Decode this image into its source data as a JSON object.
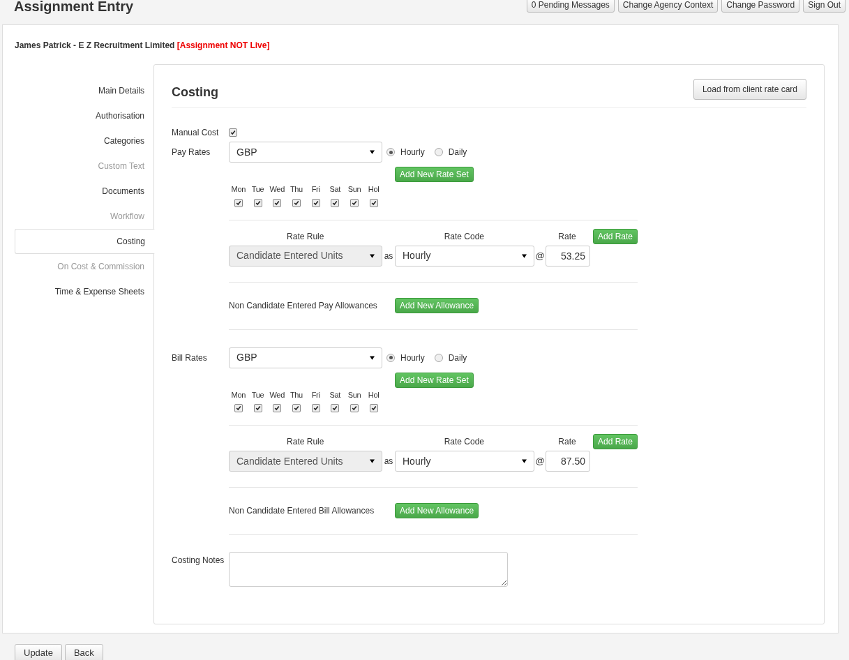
{
  "header": {
    "title": "Assignment Entry",
    "buttons": [
      "0 Pending Messages",
      "Change Agency Context",
      "Change Password",
      "Sign Out"
    ]
  },
  "candidate": {
    "name": "James Patrick - E Z Recruitment Limited",
    "status": "[Assignment NOT Live]"
  },
  "sidebar": {
    "items": [
      {
        "label": "Main Details",
        "selected": false,
        "disabled": false
      },
      {
        "label": "Authorisation",
        "selected": false,
        "disabled": false
      },
      {
        "label": "Categories",
        "selected": false,
        "disabled": false
      },
      {
        "label": "Custom Text",
        "selected": false,
        "disabled": true
      },
      {
        "label": "Documents",
        "selected": false,
        "disabled": false
      },
      {
        "label": "Workflow",
        "selected": false,
        "disabled": true
      },
      {
        "label": "Costing",
        "selected": true,
        "disabled": false
      },
      {
        "label": "On Cost & Commission",
        "selected": false,
        "disabled": true
      },
      {
        "label": "Time & Expense Sheets",
        "selected": false,
        "disabled": false
      }
    ]
  },
  "costing": {
    "title": "Costing",
    "load_button": "Load from client rate card",
    "manual_cost": {
      "label": "Manual Cost",
      "checked": true
    },
    "rate_sections": [
      {
        "label": "Pay Rates",
        "currency": "GBP",
        "periods": [
          {
            "label": "Hourly",
            "selected": true
          },
          {
            "label": "Daily",
            "selected": false
          }
        ],
        "add_rate_set": "Add New Rate Set",
        "days": [
          {
            "label": "Mon",
            "checked": true
          },
          {
            "label": "Tue",
            "checked": true
          },
          {
            "label": "Wed",
            "checked": true
          },
          {
            "label": "Thu",
            "checked": true
          },
          {
            "label": "Fri",
            "checked": true
          },
          {
            "label": "Sat",
            "checked": true
          },
          {
            "label": "Sun",
            "checked": true
          },
          {
            "label": "Hol",
            "checked": true
          }
        ],
        "rate_headers": [
          "Rate Rule",
          "Rate Code",
          "Rate"
        ],
        "add_rate": "Add Rate",
        "rate_rule": "Candidate Entered Units",
        "as": "as",
        "rate_code": "Hourly",
        "at": "@",
        "rate": "53.25",
        "allowances_label": "Non Candidate Entered Pay Allowances",
        "add_allowance": "Add New Allowance"
      },
      {
        "label": "Bill Rates",
        "currency": "GBP",
        "periods": [
          {
            "label": "Hourly",
            "selected": true
          },
          {
            "label": "Daily",
            "selected": false
          }
        ],
        "add_rate_set": "Add New Rate Set",
        "days": [
          {
            "label": "Mon",
            "checked": true
          },
          {
            "label": "Tue",
            "checked": true
          },
          {
            "label": "Wed",
            "checked": true
          },
          {
            "label": "Thu",
            "checked": true
          },
          {
            "label": "Fri",
            "checked": true
          },
          {
            "label": "Sat",
            "checked": true
          },
          {
            "label": "Sun",
            "checked": true
          },
          {
            "label": "Hol",
            "checked": true
          }
        ],
        "rate_headers": [
          "Rate Rule",
          "Rate Code",
          "Rate"
        ],
        "add_rate": "Add Rate",
        "rate_rule": "Candidate Entered Units",
        "as": "as",
        "rate_code": "Hourly",
        "at": "@",
        "rate": "87.50",
        "allowances_label": "Non Candidate Entered Bill Allowances",
        "add_allowance": "Add New Allowance"
      }
    ],
    "notes_label": "Costing Notes"
  },
  "footer_buttons": [
    "Update",
    "Back"
  ]
}
